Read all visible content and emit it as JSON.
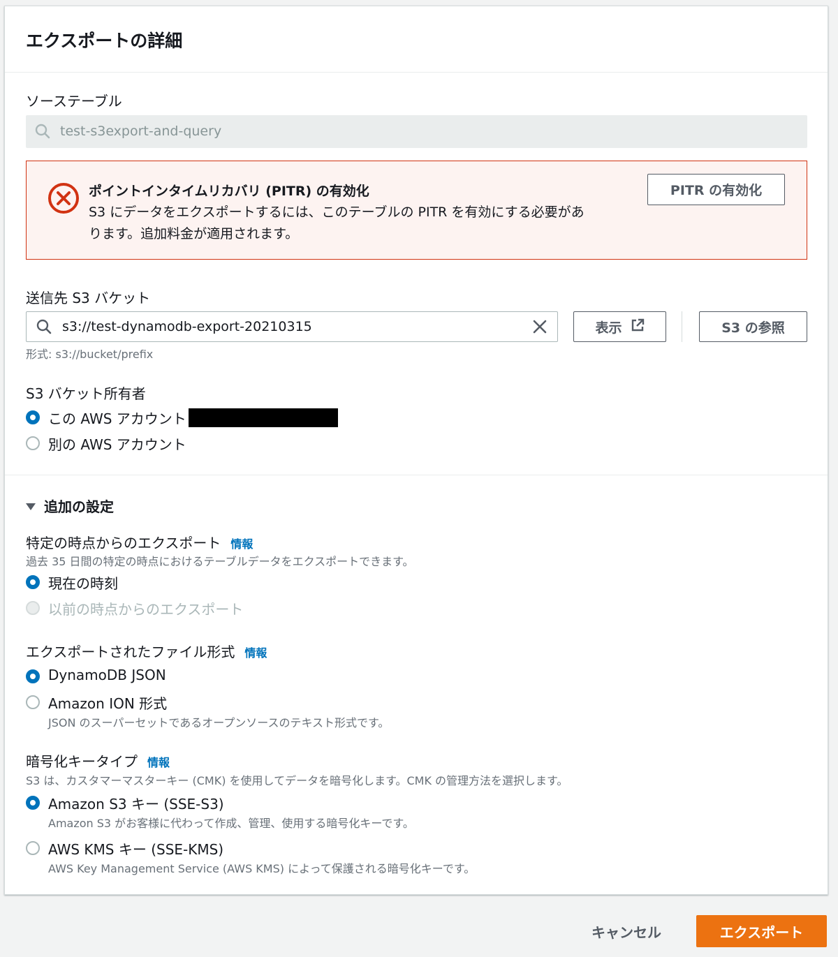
{
  "panel": {
    "title": "エクスポートの詳細"
  },
  "source_table": {
    "label": "ソーステーブル",
    "value": "test-s3export-and-query"
  },
  "pitr_alert": {
    "title": "ポイントインタイムリカバリ (PITR) の有効化",
    "body_line1": "S3 にデータをエクスポートするには、このテーブルの PITR を有効にする必要があ",
    "body_line2": "ります。追加料金が適用されます。",
    "button_label": "PITR の有効化"
  },
  "destination": {
    "label": "送信先 S3 バケット",
    "value": "s3://test-dynamodb-export-20210315",
    "format_hint": "形式: s3://bucket/prefix",
    "view_button": "表示",
    "browse_button": "S3 の参照"
  },
  "bucket_owner": {
    "label": "S3 バケット所有者",
    "options": [
      {
        "label": "この AWS アカウント",
        "checked": true
      },
      {
        "label": "別の AWS アカウント",
        "checked": false
      }
    ]
  },
  "additional_settings": {
    "label": "追加の設定"
  },
  "point_in_time": {
    "label": "特定の時点からのエクスポート",
    "info": "情報",
    "description": "過去 35 日間の特定の時点におけるテーブルデータをエクスポートできます。",
    "options": [
      {
        "label": "現在の時刻",
        "checked": true
      },
      {
        "label": "以前の時点からのエクスポート",
        "checked": false,
        "disabled": true
      }
    ]
  },
  "file_format": {
    "label": "エクスポートされたファイル形式",
    "info": "情報",
    "options": [
      {
        "label": "DynamoDB JSON",
        "checked": true
      },
      {
        "label": "Amazon ION 形式",
        "checked": false,
        "description": "JSON のスーパーセットであるオープンソースのテキスト形式です。"
      }
    ]
  },
  "encryption": {
    "label": "暗号化キータイプ",
    "info": "情報",
    "description": "S3 は、カスタマーマスターキー (CMK) を使用してデータを暗号化します。CMK の管理方法を選択します。",
    "options": [
      {
        "label": "Amazon S3 キー (SSE-S3)",
        "checked": true,
        "description": "Amazon S3 がお客様に代わって作成、管理、使用する暗号化キーです。"
      },
      {
        "label": "AWS KMS キー (SSE-KMS)",
        "checked": false,
        "description": "AWS Key Management Service (AWS KMS) によって保護される暗号化キーです。"
      }
    ]
  },
  "footer": {
    "cancel": "キャンセル",
    "export": "エクスポート"
  },
  "colors": {
    "primary": "#ec7211",
    "link": "#0073bb",
    "error": "#d13212",
    "error_bg": "#fdf3f1"
  }
}
